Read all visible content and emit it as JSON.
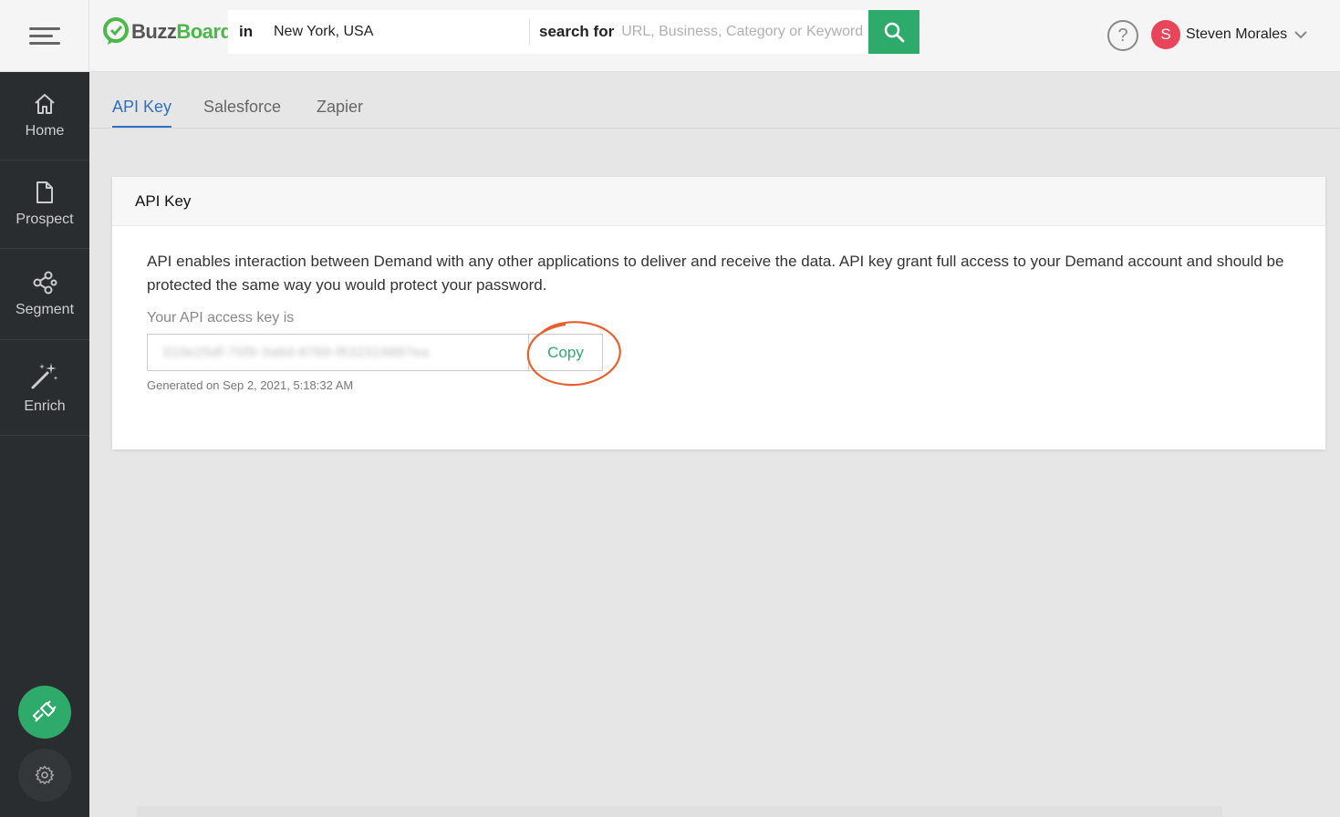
{
  "header": {
    "logo_part1": "Buzz",
    "logo_part2": "Board",
    "in_label": "in",
    "location_value": "New York, USA",
    "search_for_label": "search for",
    "search_placeholder": "URL, Business, Category or Keyword",
    "help_label": "?",
    "user": {
      "initial": "S",
      "name": "Steven Morales"
    }
  },
  "sidebar": {
    "items": [
      {
        "label": "Home",
        "icon": "home-icon"
      },
      {
        "label": "Prospect",
        "icon": "document-icon"
      },
      {
        "label": "Segment",
        "icon": "share-icon"
      },
      {
        "label": "Enrich",
        "icon": "magic-wand-icon"
      }
    ]
  },
  "tabs": [
    {
      "label": "API Key",
      "active": true
    },
    {
      "label": "Salesforce",
      "active": false
    },
    {
      "label": "Zapier",
      "active": false
    }
  ],
  "card": {
    "title": "API Key",
    "description": "API enables interaction between Demand with any other applications to deliver and receive the data. API key grant full access to your Demand account and should be protected the same way you would protect your password.",
    "key_label": "Your API access key is",
    "key_value": "310e25df-75f9-3a6d-8789-f632319887ea",
    "copy_label": "Copy",
    "generated": "Generated on Sep 2, 2021, 5:18:32 AM"
  },
  "colors": {
    "accent_green": "#2eaa6b",
    "tab_blue": "#2f6fc4",
    "avatar_red": "#e8455a",
    "annotation_orange": "#e8602c",
    "sidebar_bg": "#2a2d30"
  }
}
